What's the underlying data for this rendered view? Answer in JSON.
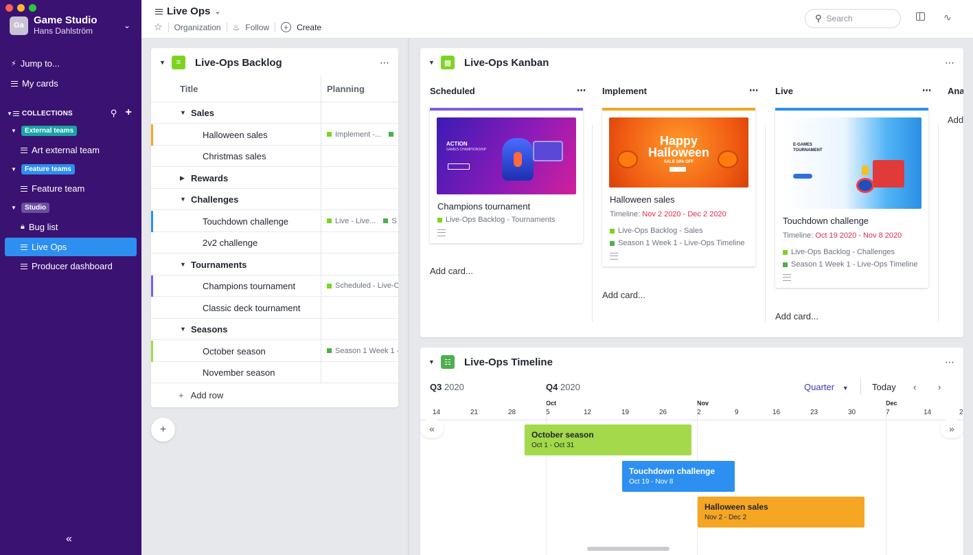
{
  "workspace": {
    "avatar": "Ga",
    "name": "Game Studio",
    "user": "Hans Dahlström"
  },
  "sidebar": {
    "jump": "Jump to...",
    "my_cards": "My cards",
    "collections_label": "COLLECTIONS",
    "groups": [
      {
        "tag": "External teams",
        "tag_color": "#1aa3a3",
        "items": [
          "Art external team"
        ]
      },
      {
        "tag": "Feature teams",
        "tag_color": "#2d8ff0",
        "items": [
          "Feature team"
        ]
      },
      {
        "tag": "Studio",
        "tag_color": "#6a4fa0",
        "items": [
          "Bug list",
          "Live Ops",
          "Producer dashboard"
        ]
      }
    ],
    "collapse_icon": "«"
  },
  "topbar": {
    "title": "Live Ops",
    "organization": "Organization",
    "follow": "Follow",
    "create": "Create",
    "search_placeholder": "Search"
  },
  "backlog": {
    "title": "Live-Ops Backlog",
    "col_title": "Title",
    "col_planning": "Planning",
    "add_row": "Add row",
    "rows": [
      {
        "type": "group",
        "label": "Sales"
      },
      {
        "type": "item",
        "label": "Halloween sales",
        "stripe": "#f5a623",
        "plan": "Implement -...",
        "plan_color": "#7ed321",
        "plan2_color": "#4caf50"
      },
      {
        "type": "item",
        "label": "Christmas sales"
      },
      {
        "type": "group",
        "label": "Rewards",
        "collapsed": true
      },
      {
        "type": "group",
        "label": "Challenges"
      },
      {
        "type": "item",
        "label": "Touchdown challenge",
        "stripe": "#2d8ff0",
        "plan": "Live - Live...",
        "plan_color": "#7ed321",
        "plan2_color": "#4caf50",
        "plan2": "S"
      },
      {
        "type": "item",
        "label": "2v2 challenge"
      },
      {
        "type": "group",
        "label": "Tournaments"
      },
      {
        "type": "item",
        "label": "Champions tournament",
        "stripe": "#7b5ce6",
        "plan": "Scheduled - Live-O",
        "plan_color": "#7ed321"
      },
      {
        "type": "item",
        "label": "Classic deck tournament"
      },
      {
        "type": "group",
        "label": "Seasons"
      },
      {
        "type": "item",
        "label": "October season",
        "stripe": "#a3d94a",
        "plan": "Season 1 Week 1 -",
        "plan_color": "#4caf50",
        "plan2_color": "#4caf50"
      },
      {
        "type": "item",
        "label": "November season"
      }
    ]
  },
  "kanban": {
    "title": "Live-Ops Kanban",
    "add_card": "Add card...",
    "columns": [
      {
        "name": "Scheduled",
        "color": "#7b5ce6",
        "card": {
          "title": "Champions tournament",
          "timeline_label": "",
          "timeline": "",
          "refs": [
            {
              "text": "Live-Ops Backlog - Tournaments",
              "color": "#7ed321"
            }
          ],
          "image": {
            "headline": "ACTION",
            "sub": "GAMES CHAMPIONSHIP"
          }
        }
      },
      {
        "name": "Implement",
        "color": "#f5a623",
        "card": {
          "title": "Halloween sales",
          "timeline_label": "Timeline:",
          "timeline": "Nov 2 2020 - Dec 2 2020",
          "refs": [
            {
              "text": "Live-Ops Backlog - Sales",
              "color": "#7ed321"
            },
            {
              "text": "Season 1 Week 1 - Live-Ops Timeline",
              "color": "#4caf50"
            }
          ],
          "image": {
            "headline": "Happy Halloween",
            "sub": "SALE 50% OFF"
          }
        }
      },
      {
        "name": "Live",
        "color": "#2d8ff0",
        "card": {
          "title": "Touchdown challenge",
          "timeline_label": "Timeline:",
          "timeline": "Oct 19 2020 - Nov 8 2020",
          "refs": [
            {
              "text": "Live-Ops Backlog - Challenges",
              "color": "#7ed321"
            },
            {
              "text": "Season 1 Week 1 - Live-Ops Timeline",
              "color": "#4caf50"
            }
          ],
          "image": {
            "headline": "E-GAMES TOURNAMENT",
            "sub": ""
          }
        }
      },
      {
        "name": "Ana",
        "color": "",
        "card": null,
        "add_card": "Add"
      }
    ]
  },
  "timeline": {
    "title": "Live-Ops Timeline",
    "q3": "Q3",
    "q3_year": "2020",
    "q4": "Q4",
    "q4_year": "2020",
    "zoom": "Quarter",
    "today": "Today",
    "months": [
      "Oct",
      "Nov",
      "Dec"
    ],
    "days": [
      "14",
      "21",
      "28",
      "5",
      "12",
      "19",
      "26",
      "2",
      "9",
      "16",
      "23",
      "30",
      "7",
      "14",
      "2"
    ],
    "bars": [
      {
        "title": "October season",
        "dates": "Oct 1 - Oct 31",
        "color": "#a3d94a",
        "text": "#1f2430"
      },
      {
        "title": "Touchdown challenge",
        "dates": "Oct 19 - Nov 8",
        "color": "#2d8ff0",
        "text": "#ffffff"
      },
      {
        "title": "Halloween sales",
        "dates": "Nov 2 - Dec 2",
        "color": "#f5a623",
        "text": "#1f2430"
      }
    ]
  },
  "colors": {
    "sidebar_bg": "#3a1271",
    "accent": "#2d8ff0",
    "kanban_icon": "#7ed321",
    "backlog_icon": "#7ed321",
    "timeline_icon": "#4caf50"
  }
}
